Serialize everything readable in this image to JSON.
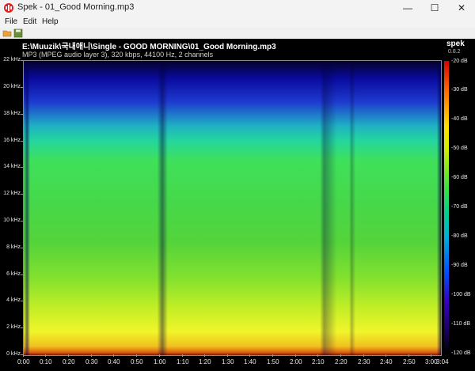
{
  "window": {
    "title": "Spek - 01_Good Morning.mp3",
    "icon": "spek-app-icon",
    "controls": {
      "minimize": "—",
      "maximize": "☐",
      "close": "✕"
    }
  },
  "menu": {
    "items": [
      "File",
      "Edit",
      "Help"
    ]
  },
  "toolbar": {
    "icons": [
      "open-file-icon",
      "save-icon"
    ]
  },
  "file": {
    "path": "E:\\Muuzik\\국내애니\\Single - GOOD MORNING\\01_Good Morning.mp3",
    "info": "MP3 (MPEG audio layer 3), 320 kbps, 44100 Hz, 2 channels"
  },
  "brand": {
    "name": "spek",
    "version": "0.8.2"
  },
  "axes": {
    "y_labels": [
      "22 kHz",
      "20 kHz",
      "18 kHz",
      "16 kHz",
      "14 kHz",
      "12 kHz",
      "10 kHz",
      "8 kHz",
      "6 kHz",
      "4 kHz",
      "2 kHz",
      "0 kHz"
    ],
    "x_labels": [
      "0:00",
      "0:10",
      "0:20",
      "0:30",
      "0:40",
      "0:50",
      "1:00",
      "1:10",
      "1:20",
      "1:30",
      "1:40",
      "1:50",
      "2:00",
      "2:10",
      "2:20",
      "2:30",
      "2:40",
      "2:50",
      "3:00",
      "3:04"
    ],
    "db_labels": [
      "-20 dB",
      "-30 dB",
      "-40 dB",
      "-50 dB",
      "-60 dB",
      "-70 dB",
      "-80 dB",
      "-90 dB",
      "-100 dB",
      "-110 dB",
      "-120 dB"
    ]
  }
}
